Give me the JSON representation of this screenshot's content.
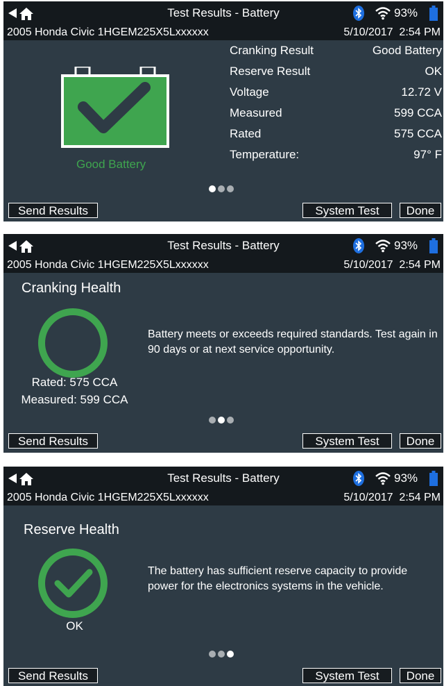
{
  "header": {
    "title": "Test Results - Battery",
    "battery_percent": "93%",
    "vehicle": "2005 Honda Civic 1HGEM225X5Lxxxxxx",
    "datetime": "5/10/2017  2:54 PM"
  },
  "buttons": {
    "send": "Send Results",
    "system_test": "System Test",
    "done": "Done"
  },
  "screen1": {
    "status_label": "Good Battery",
    "results": [
      {
        "label": "Cranking Result",
        "value": "Good Battery"
      },
      {
        "label": "Reserve Result",
        "value": "OK"
      },
      {
        "label": "Voltage",
        "value": "12.72 V"
      },
      {
        "label": "Measured",
        "value": "599 CCA"
      },
      {
        "label": "Rated",
        "value": "575 CCA"
      },
      {
        "label": "Temperature:",
        "value": "97° F"
      }
    ],
    "active_page": 1
  },
  "screen2": {
    "section_title": "Cranking Health",
    "message": "Battery meets or exceeds required standards. Test again in 90 days or at next service opportunity.",
    "rated": "Rated: 575 CCA",
    "measured": "Measured: 599 CCA",
    "active_page": 2
  },
  "screen3": {
    "section_title": "Reserve Health",
    "message": "The battery has sufficient reserve capacity to provide power for the electronics systems in the vehicle.",
    "status": "OK",
    "active_page": 3
  },
  "colors": {
    "accent_green": "#3fa54f",
    "panel_bg": "#2e3b45",
    "bar_bg": "#14191d",
    "battery_blue": "#1e6fe0"
  },
  "icons": [
    "back-arrow-icon",
    "home-icon",
    "bluetooth-icon",
    "wifi-icon",
    "battery-icon",
    "battery-check-icon",
    "check-circle-icon",
    "gauge-ring-icon"
  ]
}
